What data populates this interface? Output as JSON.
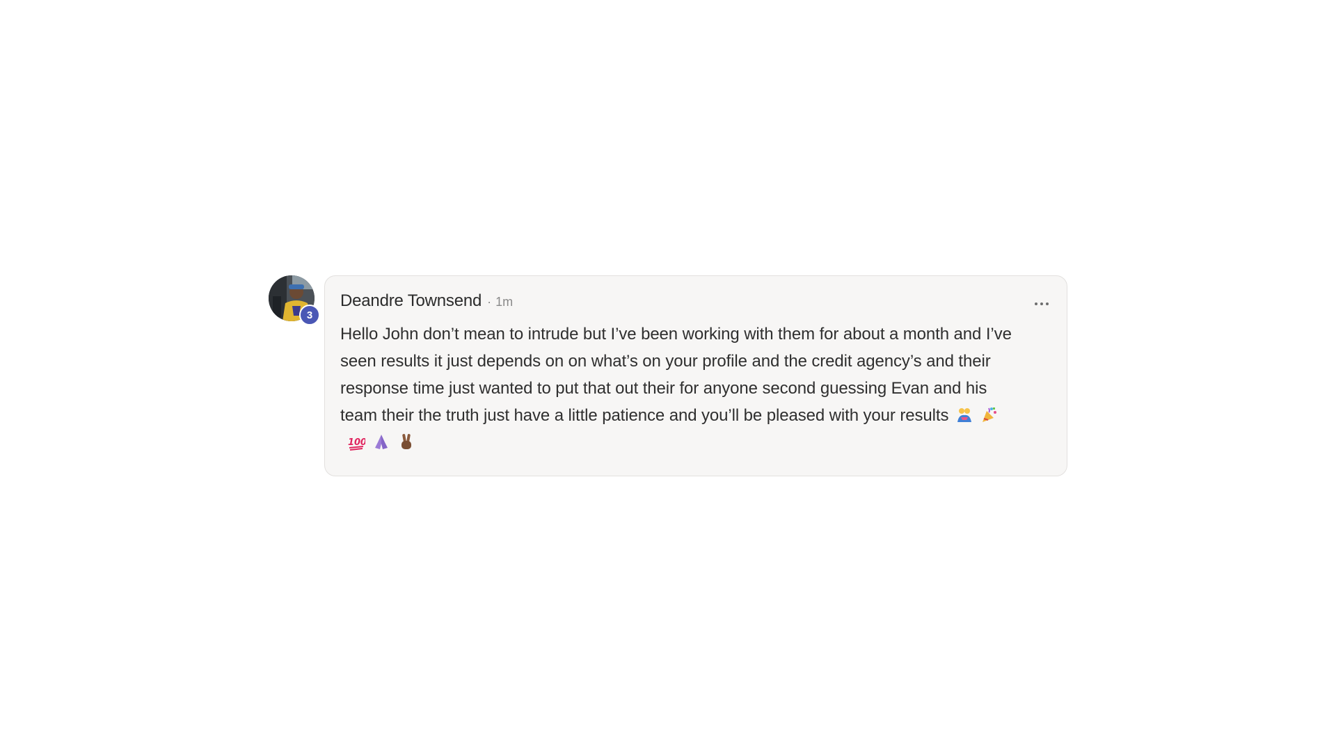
{
  "comment": {
    "author": "Deandre Townsend",
    "separator": "·",
    "time": "1m",
    "avatar_badge": "3",
    "body": "Hello John don’t mean to intrude but I’ve been working with them for about a month and I’ve seen results it just depends on on what’s on your profile and the credit agency’s and their response time just wanted to put that out their for anyone second guessing Evan and his team their the truth just have a little patience and you’ll be pleased with your results",
    "emojis": [
      "people-hugging-emoji",
      "party-popper-emoji",
      "hundred-points-emoji",
      "folded-hands-emoji",
      "victory-hand-emoji"
    ],
    "more_icon": "ellipsis-icon"
  },
  "colors": {
    "bubble_bg": "#f7f6f5",
    "badge_bg": "#4a57b5",
    "text": "#2f2f2f",
    "muted": "#8a8a8a"
  }
}
